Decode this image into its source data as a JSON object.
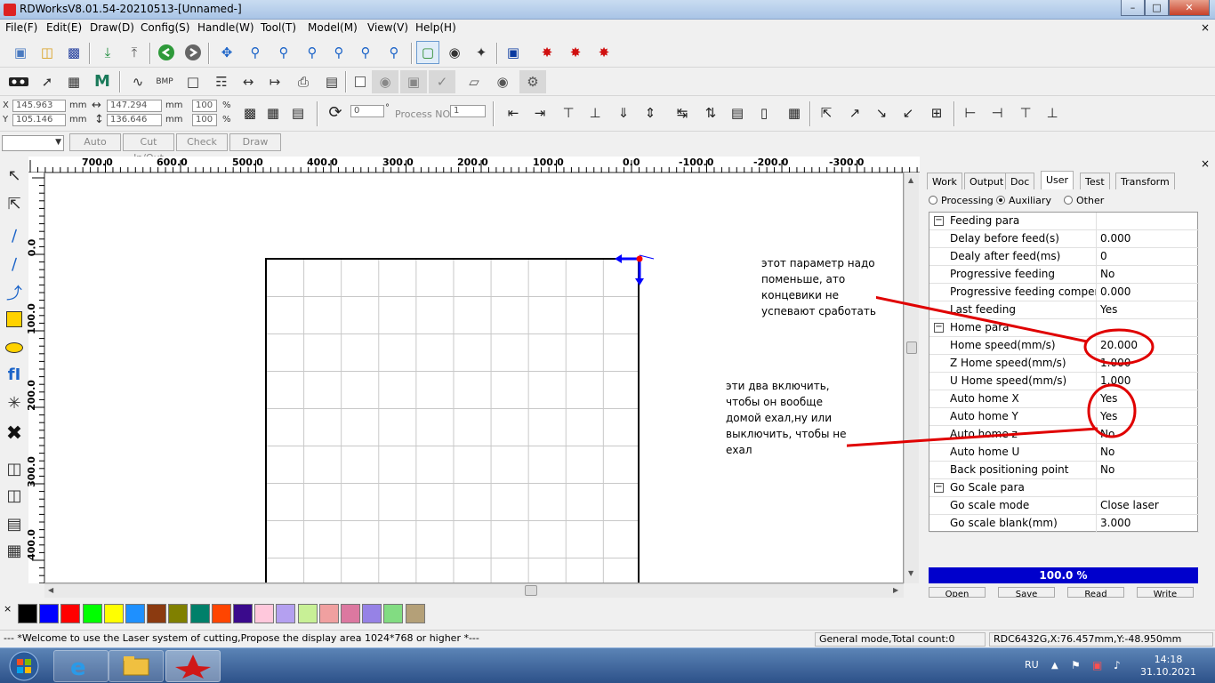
{
  "window": {
    "title": "RDWorksV8.01.54-20210513-[Unnamed-]",
    "min": "–",
    "max": "□",
    "close": "✕"
  },
  "menu": [
    "File(F)",
    "Edit(E)",
    "Draw(D)",
    "Config(S)",
    "Handle(W)",
    "Tool(T)",
    "Model(M)",
    "View(V)",
    "Help(H)"
  ],
  "menu_close": "×",
  "pos": {
    "x_label": "X",
    "y_label": "Y",
    "x": "145.963",
    "y": "105.146",
    "unit": "mm",
    "w": "147.294",
    "h": "136.646",
    "w_pct": "100",
    "h_pct": "100",
    "pct": "%"
  },
  "rotate": {
    "value": "0",
    "deg": "°",
    "process_label": "Process NO:",
    "process_no": "1"
  },
  "gen_buttons": [
    "Auto",
    "Cut In/Out",
    "Check",
    "Draw"
  ],
  "ruler": {
    "h": [
      "700.0",
      "600.0",
      "500.0",
      "400.0",
      "300.0",
      "200.0",
      "100.0",
      "0.0",
      "-100.0",
      "-200.0",
      "-300.0"
    ],
    "v": [
      "0.0",
      "100.0",
      "200.0",
      "300.0",
      "400.0"
    ]
  },
  "panel": {
    "close": "×",
    "tabs": [
      "Work",
      "Output",
      "Doc",
      "User",
      "Test",
      "Transform"
    ],
    "active_tab": "User",
    "radios": [
      "Processing",
      "Auxiliary",
      "Other"
    ],
    "selected_radio": "Auxiliary",
    "rows": [
      {
        "type": "group",
        "name": "Feeding para",
        "sign": "−"
      },
      {
        "name": "Delay before feed(s)",
        "value": "0.000"
      },
      {
        "name": "Dealy after feed(ms)",
        "value": "0"
      },
      {
        "name": "Progressive feeding",
        "value": "No"
      },
      {
        "name": "Progressive feeding compensation",
        "value": "0.000"
      },
      {
        "name": "Last feeding",
        "value": "Yes"
      },
      {
        "type": "group",
        "name": "Home para",
        "sign": "−"
      },
      {
        "name": "Home speed(mm/s)",
        "value": "20.000"
      },
      {
        "name": "Z Home speed(mm/s)",
        "value": "1.000"
      },
      {
        "name": "U Home speed(mm/s)",
        "value": "1.000"
      },
      {
        "name": "Auto home X",
        "value": "Yes"
      },
      {
        "name": "Auto home Y",
        "value": "Yes"
      },
      {
        "name": "Auto home z",
        "value": "No"
      },
      {
        "name": "Auto home U",
        "value": "No"
      },
      {
        "name": "Back positioning point",
        "value": "No"
      },
      {
        "type": "group",
        "name": "Go Scale para",
        "sign": "−"
      },
      {
        "name": "Go scale mode",
        "value": "Close laser"
      },
      {
        "name": "Go scale blank(mm)",
        "value": "3.000"
      }
    ],
    "progress_text": "100.0   %",
    "progress": 1.0,
    "buttons": [
      "Open",
      "Save",
      "Read",
      "Write"
    ]
  },
  "palette": {
    "close": "×",
    "colors": [
      "#000000",
      "#0000ff",
      "#ff0000",
      "#00ff00",
      "#ffff00",
      "#1e90ff",
      "#8b3a10",
      "#808000",
      "#00806a",
      "#ff4500",
      "#3a0a8c",
      "#ffc8dc",
      "#b4a0f0",
      "#c8f096",
      "#f0a0a0",
      "#dc78a0",
      "#9682e6",
      "#82dc82",
      "#b4a078"
    ]
  },
  "status": {
    "welcome": "--- *Welcome to use the Laser system of cutting,Propose the display area 1024*768 or higher *---",
    "mode": "General mode,Total count:0",
    "device": "RDC6432G,X:76.457mm,Y:-48.950mm"
  },
  "taskbar": {
    "lang": "RU",
    "time": "14:18",
    "date": "31.10.2021"
  },
  "annotations": {
    "note1": [
      "этот параметр надо",
      "поменьше, ато",
      "концевики не",
      "успевают сработать"
    ],
    "note2": [
      "эти два включить,",
      "чтобы он вообще",
      "домой ехал,ну  или",
      "выключить, чтобы не",
      "ехал"
    ],
    "color": "#e00000"
  }
}
